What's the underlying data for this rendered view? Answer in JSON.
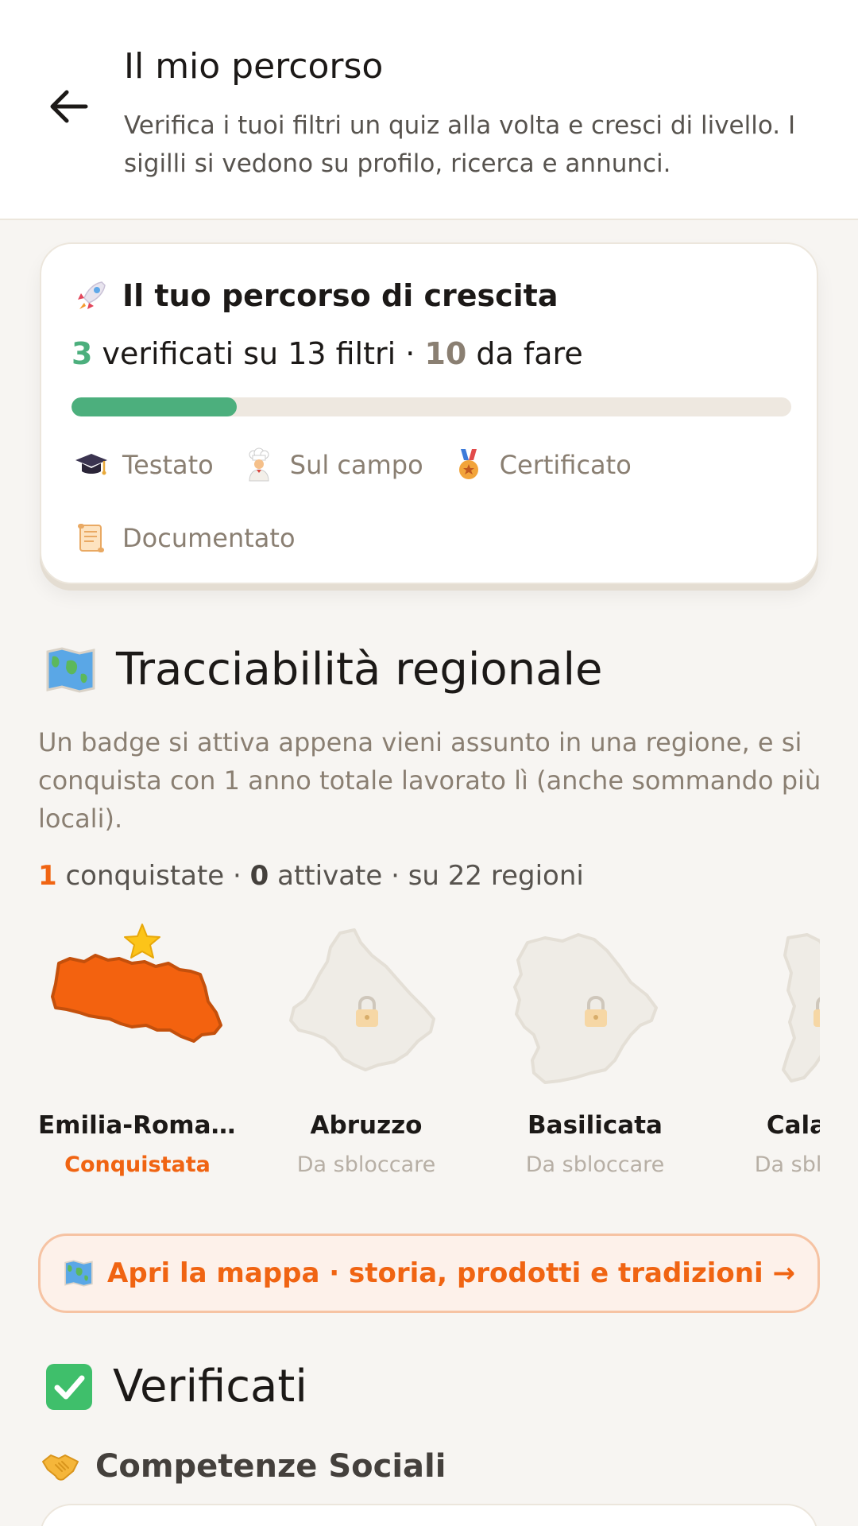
{
  "header": {
    "title": "Il mio percorso",
    "subtitle": "Verifica i tuoi filtri un quiz alla volta e cresci di livello. I sigilli si vedono su profilo, ricerca e annunci."
  },
  "progress_card": {
    "title": "Il tuo percorso di crescita",
    "verified_count": "3",
    "verified_text": " verificati su 13 filtri · ",
    "todo_count": "10",
    "todo_text": " da fare",
    "progress": 0.23,
    "legend": [
      {
        "icon": "graduation-cap-icon",
        "label": "Testato"
      },
      {
        "icon": "chef-icon",
        "label": "Sul campo"
      },
      {
        "icon": "medal-icon",
        "label": "Certificato"
      },
      {
        "icon": "scroll-icon",
        "label": "Documentato"
      }
    ]
  },
  "regional": {
    "title": "Tracciabilità regionale",
    "description": "Un badge si attiva appena vieni assunto in una regione, e si conquista con 1 anno totale lavorato lì (anche sommando più locali).",
    "conquered_count": "1",
    "conquered_text": " conquistate · ",
    "activated_count": "0",
    "activated_text": " attivate · su 22 regioni",
    "regions": [
      {
        "name": "Emilia-Romag…",
        "status": "Conquistata",
        "state": "won"
      },
      {
        "name": "Abruzzo",
        "status": "Da sbloccare",
        "state": "locked"
      },
      {
        "name": "Basilicata",
        "status": "Da sbloccare",
        "state": "locked"
      },
      {
        "name": "Calabria",
        "status": "Da sbloccare",
        "state": "locked"
      }
    ],
    "map_button": "Apri la mappa · storia, prodotti e tradizioni →"
  },
  "verified": {
    "title": "Verificati",
    "group_title": "Competenze Sociali"
  },
  "colors": {
    "accent_orange": "#f06412",
    "accent_green": "#4caf7d",
    "background": "#f7f5f2"
  }
}
